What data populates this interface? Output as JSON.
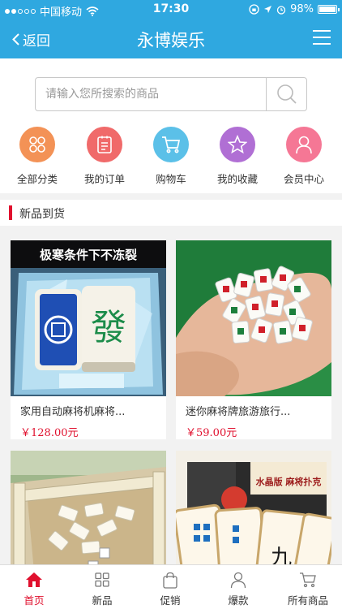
{
  "status_bar": {
    "carrier": "中国移动",
    "time": "17:30",
    "battery": "98%",
    "battery_level": 0.98
  },
  "header": {
    "back_label": "返回",
    "title": "永博娱乐"
  },
  "search": {
    "placeholder": "请输入您所搜索的商品"
  },
  "categories": [
    {
      "label": "全部分类",
      "color": "#f39256",
      "icon": "grid-icon"
    },
    {
      "label": "我的订单",
      "color": "#f06a6a",
      "icon": "order-list-icon"
    },
    {
      "label": "购物车",
      "color": "#5bc0e8",
      "icon": "cart-icon"
    },
    {
      "label": "我的收藏",
      "color": "#b06fd4",
      "icon": "star-icon"
    },
    {
      "label": "会员中心",
      "color": "#f57795",
      "icon": "user-icon"
    }
  ],
  "section": {
    "title": "新品到货"
  },
  "products": [
    {
      "name": "家用自动麻将机麻将...",
      "price": "￥128.00元",
      "banner": "极寒条件下不冻裂",
      "tile_char": "發"
    },
    {
      "name": "迷你麻将牌旅游旅行...",
      "price": "￥59.00元"
    },
    {
      "name": "",
      "price": ""
    },
    {
      "name": "",
      "price": "",
      "banner": "水晶版 麻将扑克"
    }
  ],
  "tabs": [
    {
      "label": "首页",
      "icon": "home-icon",
      "active": true
    },
    {
      "label": "新品",
      "icon": "grid-icon"
    },
    {
      "label": "促销",
      "icon": "bag-icon"
    },
    {
      "label": "爆款",
      "icon": "person-icon"
    },
    {
      "label": "所有商品",
      "icon": "cart-icon"
    }
  ],
  "colors": {
    "header_bg": "#2fa8e0",
    "accent_red": "#e0102e"
  }
}
